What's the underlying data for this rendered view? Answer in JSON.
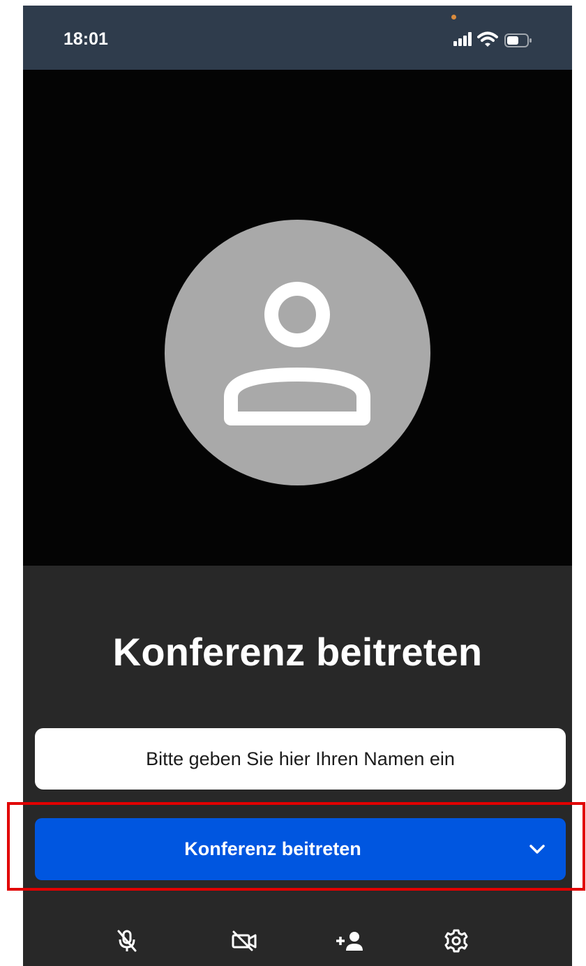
{
  "status_bar": {
    "time": "18:01",
    "icons": [
      "camera-indicator-dot",
      "cellular-signal-icon",
      "wifi-icon",
      "battery-icon"
    ]
  },
  "preview": {
    "placeholder_icon": "user-avatar-icon"
  },
  "join": {
    "title": "Konferenz beitreten",
    "name_input": {
      "value": "",
      "placeholder": "Bitte geben Sie hier Ihren Namen ein"
    },
    "join_button_label": "Konferenz beitreten",
    "join_button_icon": "chevron-down-icon"
  },
  "toolbar": {
    "items": [
      {
        "icon": "microphone-off-icon"
      },
      {
        "icon": "camera-off-icon"
      },
      {
        "icon": "invite-person-icon"
      },
      {
        "icon": "gear-icon"
      }
    ]
  },
  "colors": {
    "status_bar": "#2f3c4c",
    "preview_bg": "#040404",
    "panel_bg": "#282828",
    "avatar": "#a9a9a9",
    "primary_button": "#0056e0",
    "highlight": "#e10000"
  }
}
